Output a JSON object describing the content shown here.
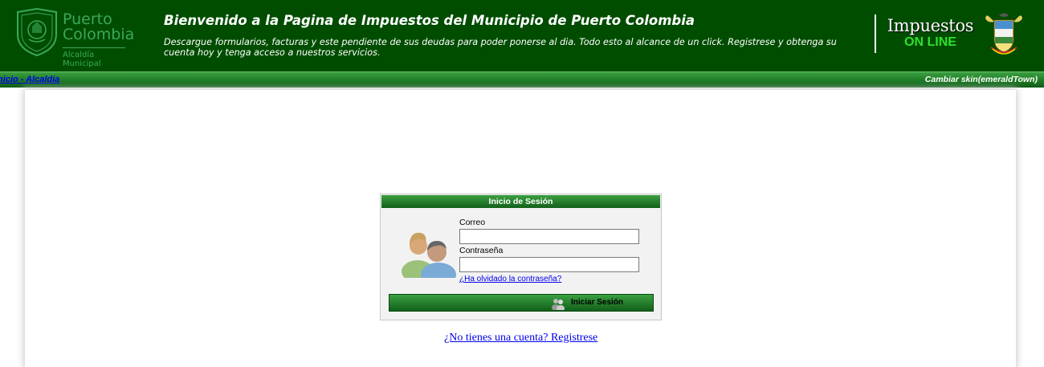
{
  "header": {
    "logo": {
      "line1": "Puerto",
      "line2": "Colombia",
      "line3": "Alcaldía Municipal"
    },
    "title": "Bienvenido a la Pagina de Impuestos del Municipio de Puerto Colombia",
    "description": "Descargue formularios, facturas y este pendiente de sus deudas para poder ponerse al dia. Todo esto al alcance de un click. Registrese y obtenga su cuenta hoy y tenga acceso a nuestros servicios.",
    "brand": {
      "line1": "Impuestos",
      "line2": "ON LINE"
    },
    "colors": {
      "background": "#004d00",
      "accent": "#2ee02e",
      "logo": "#3aa85a"
    }
  },
  "nav": {
    "breadcrumb": "Inicio - Alcaldia",
    "skin": "Cambiar skin(emeraldTown)"
  },
  "login": {
    "title": "Inicio de Sesión",
    "email_label": "Correo",
    "email_value": "",
    "password_label": "Contraseña",
    "password_value": "",
    "forgot_link": "¿Ha olvidado la contraseña?",
    "submit_label": "Iniciar Sesión",
    "icon": "users-icon"
  },
  "register_link": "¿No tienes una cuenta? Registrese"
}
